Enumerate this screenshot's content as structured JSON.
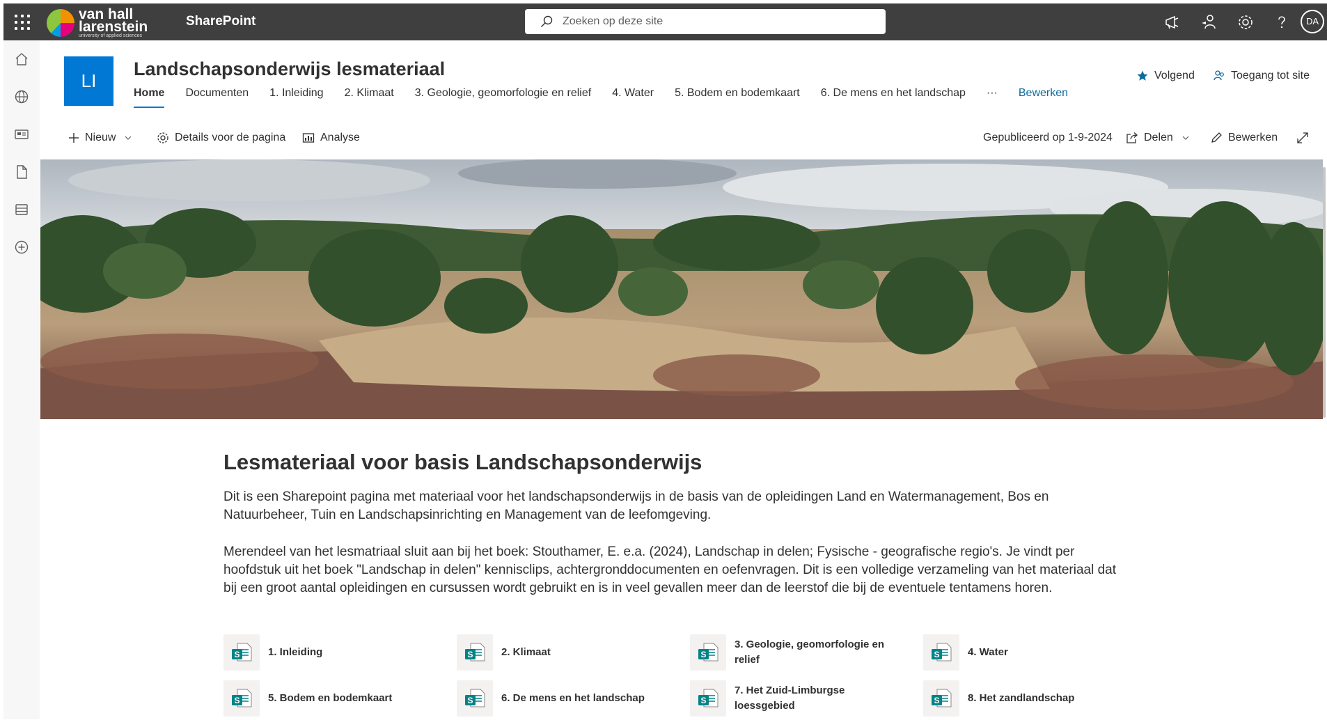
{
  "suite": {
    "app_name": "SharePoint",
    "logo_line1": "van hall",
    "logo_line2": "larenstein",
    "logo_tagline": "university of applied sciences",
    "search_placeholder": "Zoeken op deze site",
    "avatar_initials": "DA",
    "icons": [
      "waffle-icon",
      "megaphone-icon",
      "share-people-icon",
      "gear-icon",
      "help-icon"
    ]
  },
  "appbar": {
    "icons": [
      "home-icon",
      "globe-icon",
      "news-icon",
      "file-icon",
      "list-icon",
      "add-icon"
    ]
  },
  "site": {
    "logo_initials": "LI",
    "title": "Landschapsonderwijs lesmateriaal",
    "nav": [
      {
        "label": "Home",
        "active": true
      },
      {
        "label": "Documenten"
      },
      {
        "label": "1. Inleiding"
      },
      {
        "label": "2. Klimaat"
      },
      {
        "label": "3. Geologie, geomorfologie en relief"
      },
      {
        "label": "4. Water"
      },
      {
        "label": "5. Bodem en bodemkaart"
      },
      {
        "label": "6. De mens en het landschap"
      }
    ],
    "nav_more": "···",
    "nav_edit": "Bewerken",
    "follow_label": "Volgend",
    "access_label": "Toegang tot site"
  },
  "commandbar": {
    "new_label": "Nieuw",
    "details_label": "Details voor de pagina",
    "analysis_label": "Analyse",
    "published": "Gepubliceerd op 1-9-2024",
    "share_label": "Delen",
    "edit_label": "Bewerken"
  },
  "content": {
    "heading": "Lesmateriaal voor basis Landschapsonderwijs",
    "paragraph1": "Dit is een Sharepoint pagina met  materiaal voor het landschapsonderwijs in de basis van de opleidingen Land en Watermanagement, Bos en Natuurbeheer, Tuin en Landschapsinrichting en Management van de leefomgeving.",
    "paragraph2": "Merendeel van het lesmatriaal sluit aan bij het boek: Stouthamer, E. e.a. (2024), Landschap in delen; Fysische - geografische regio's. Je vindt per hoofdstuk uit het boek \"Landschap in delen\" kennisclips, achtergronddocumenten en oefenvragen. Dit is een volledige verzameling van het materiaal dat bij een groot aantal opleidingen en cursussen wordt gebruikt en is in veel gevallen meer dan de leerstof die bij de eventuele tentamens horen."
  },
  "quicklinks": [
    {
      "label": "1. Inleiding"
    },
    {
      "label": "2. Klimaat"
    },
    {
      "label": "3. Geologie, geomorfologie en relief"
    },
    {
      "label": "4. Water"
    },
    {
      "label": "5. Bodem en bodemkaart"
    },
    {
      "label": "6. De mens en het landschap"
    },
    {
      "label": "7. Het Zuid-Limburgse loessgebied"
    },
    {
      "label": "8. Het zandlandschap"
    }
  ],
  "colors": {
    "suitebar": "#3f3f3f",
    "accent": "#0078d4",
    "sharepoint_icon": "#038387"
  }
}
